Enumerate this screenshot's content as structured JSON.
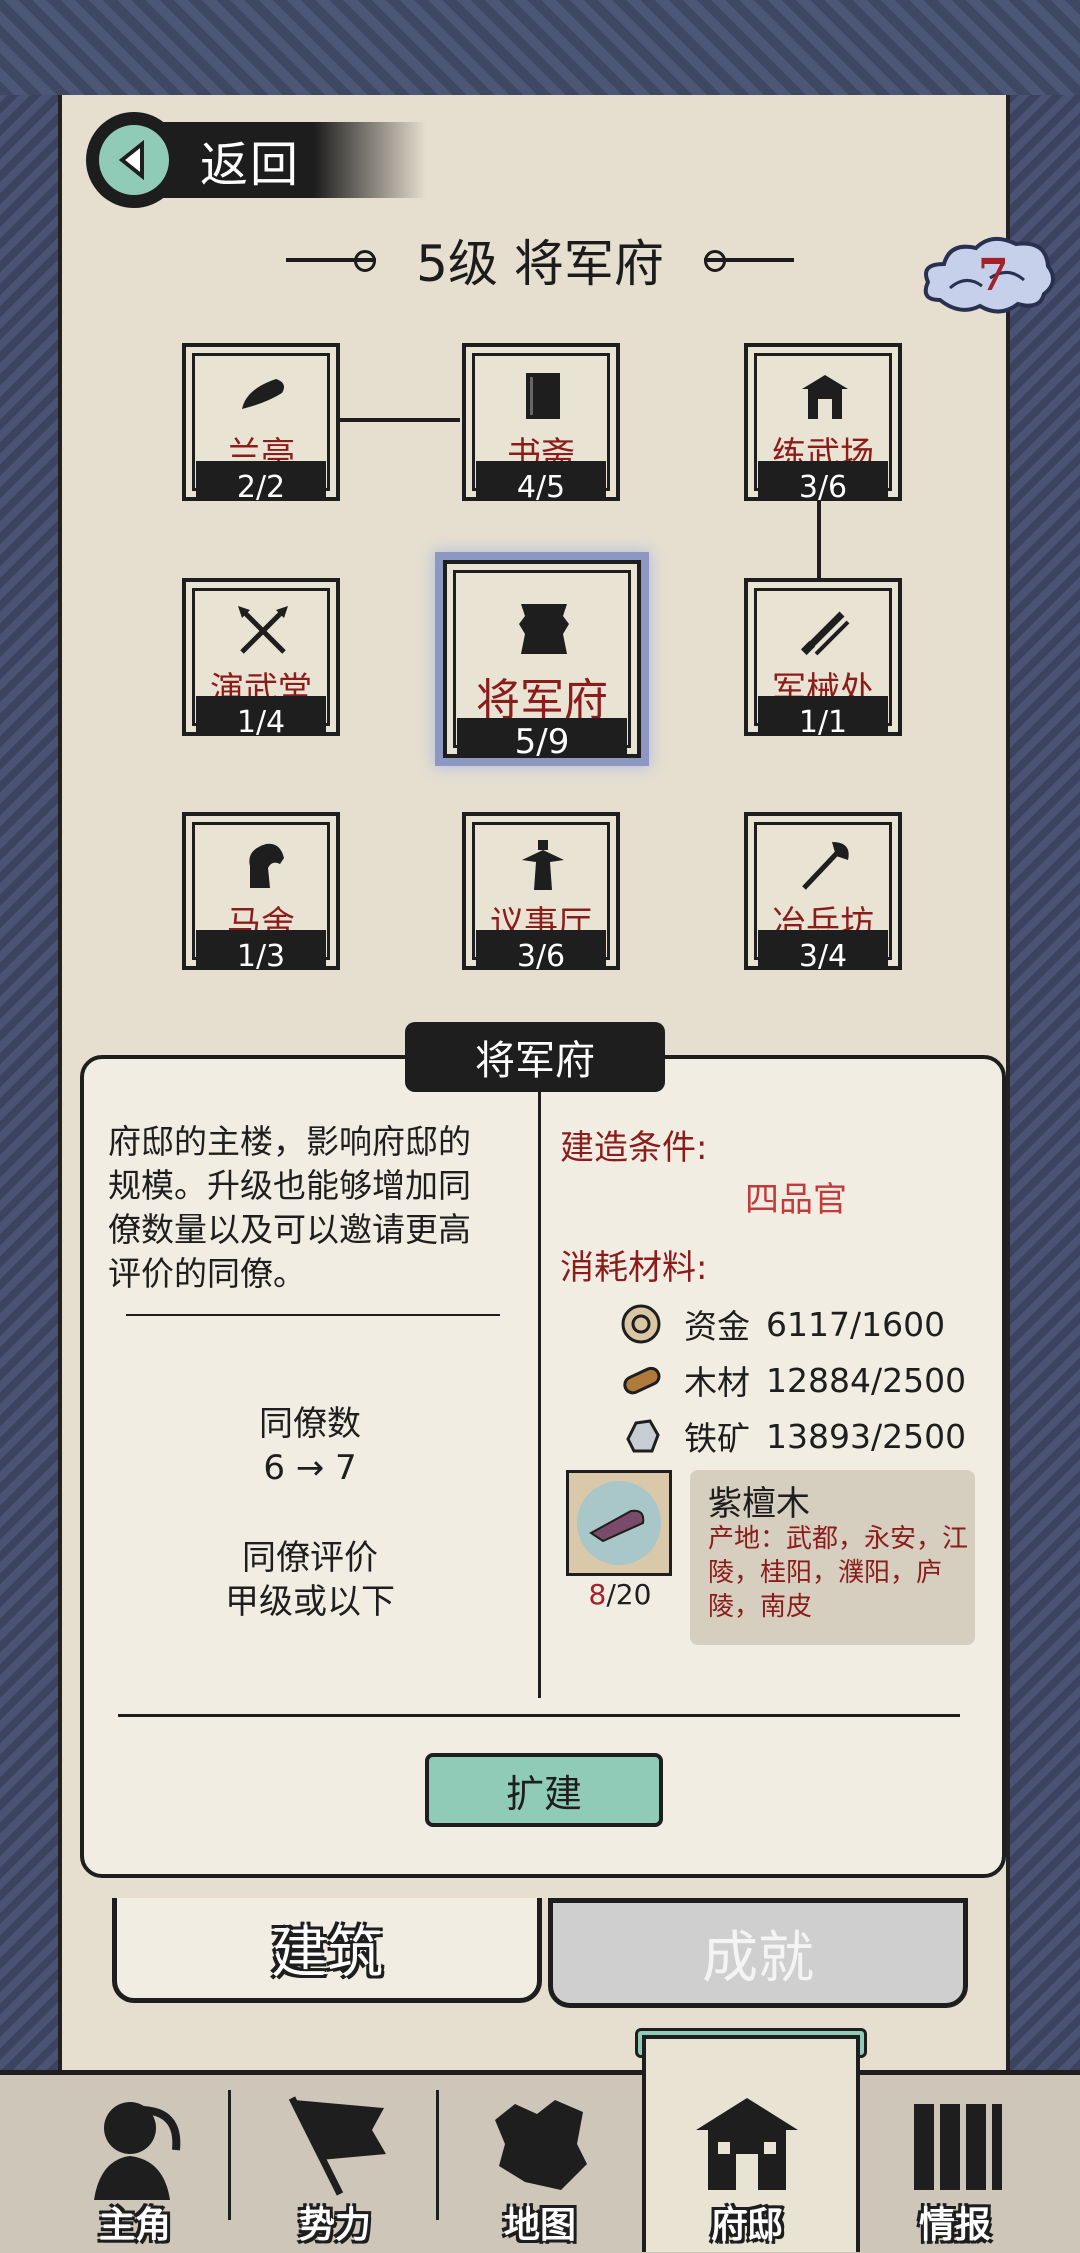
{
  "header": {
    "back_label": "返回",
    "title": "5级 将军府",
    "badge_count": "7"
  },
  "buildings": [
    {
      "name": "兰亭",
      "count": "2/2"
    },
    {
      "name": "书斋",
      "count": "4/5"
    },
    {
      "name": "练武场",
      "count": "3/6"
    },
    {
      "name": "演武堂",
      "count": "1/4"
    },
    {
      "name": "将军府",
      "count": "5/9"
    },
    {
      "name": "军械处",
      "count": "1/1"
    },
    {
      "name": "马舍",
      "count": "1/3"
    },
    {
      "name": "议事厅",
      "count": "3/6"
    },
    {
      "name": "冶兵坊",
      "count": "3/4"
    }
  ],
  "panel": {
    "title": "将军府",
    "description": "府邸的主楼，影响府邸的规模。升级也能够增加同僚数量以及可以邀请更高评价的同僚。",
    "stat1_label": "同僚数",
    "stat1_value": "6 → 7",
    "stat2_label": "同僚评价",
    "stat2_value": "甲级或以下",
    "condition_label": "建造条件:",
    "condition_value": "四品官",
    "materials_label": "消耗材料:",
    "materials": [
      {
        "icon": "coin-icon",
        "name": "资金",
        "amount": "6117/1600"
      },
      {
        "icon": "wood-icon",
        "name": "木材",
        "amount": "12884/2500"
      },
      {
        "icon": "iron-ore-icon",
        "name": "铁矿",
        "amount": "13893/2500"
      }
    ],
    "special_item": {
      "name": "紫檀木",
      "have": "8",
      "need": "/20",
      "origin": "产地：武都，永安，江陵，桂阳，濮阳，庐陵，南皮"
    },
    "expand_button": "扩建"
  },
  "tabs": {
    "build": "建筑",
    "achievement": "成就"
  },
  "bottom_nav": [
    {
      "label": "主角",
      "icon": "character-icon"
    },
    {
      "label": "势力",
      "icon": "flag-icon"
    },
    {
      "label": "地图",
      "icon": "map-icon"
    },
    {
      "label": "府邸",
      "icon": "mansion-icon"
    },
    {
      "label": "情报",
      "icon": "scroll-icon"
    }
  ],
  "colors": {
    "accent": "#8fcbb6",
    "red": "#8b1c1c",
    "paper": "#e6dfcf",
    "ink": "#1e1e1e"
  }
}
